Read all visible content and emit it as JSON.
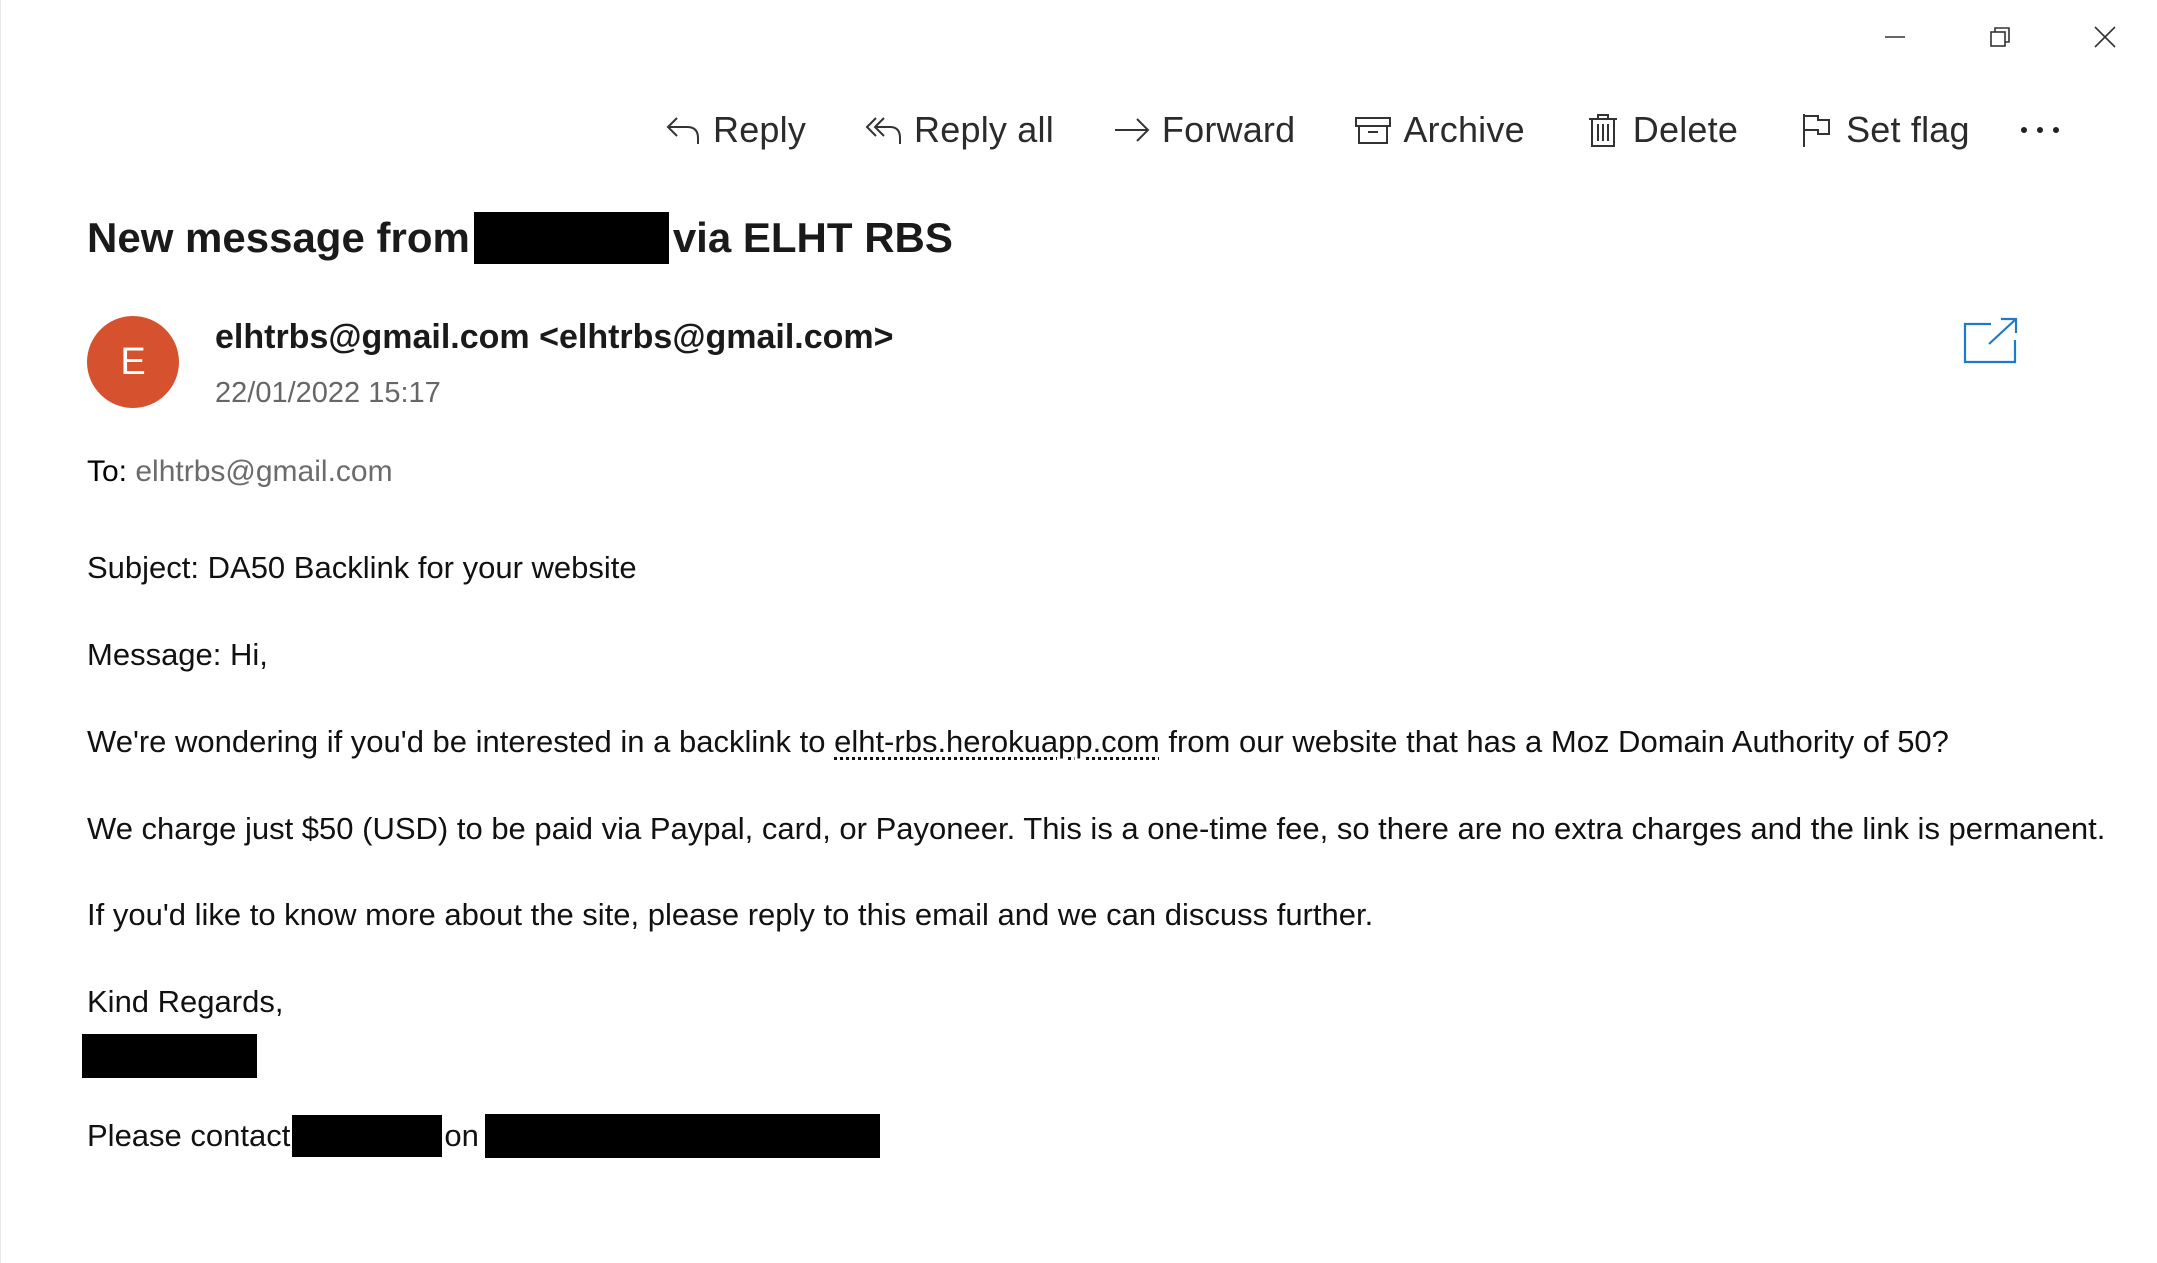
{
  "window_controls": {
    "minimize": "minimize-icon",
    "restore": "restore-icon",
    "close": "close-icon"
  },
  "toolbar": {
    "reply_label": "Reply",
    "reply_all_label": "Reply all",
    "forward_label": "Forward",
    "archive_label": "Archive",
    "delete_label": "Delete",
    "set_flag_label": "Set flag",
    "more_icon": "more-icon"
  },
  "message": {
    "subject_prefix": "New message from",
    "subject_suffix": "via ELHT RBS",
    "avatar_initial": "E",
    "avatar_color": "#d6522f",
    "sender": "elhtrbs@gmail.com <elhtrbs@gmail.com>",
    "date": "22/01/2022 15:17",
    "to_label": "To:",
    "to_address": "elhtrbs@gmail.com"
  },
  "body": {
    "subject_line": "Subject: DA50 Backlink for your website",
    "message_line": "Message: Hi,",
    "wonder_before": "We're wondering if you'd be interested in a backlink to ",
    "wonder_link": "elht-rbs.herokuapp.com",
    "wonder_after": " from our website that has a Moz Domain Authority of 50?",
    "charge_line": "We charge just $50 (USD) to be paid via Paypal, card, or Payoneer. This is a one-time fee, so there are no extra charges and the link is permanent.",
    "more_line": "If you'd like to know more about the site, please reply to this email and we can discuss further.",
    "regards_line": "Kind Regards,",
    "contact_before": "Please contact",
    "contact_on": "on"
  }
}
